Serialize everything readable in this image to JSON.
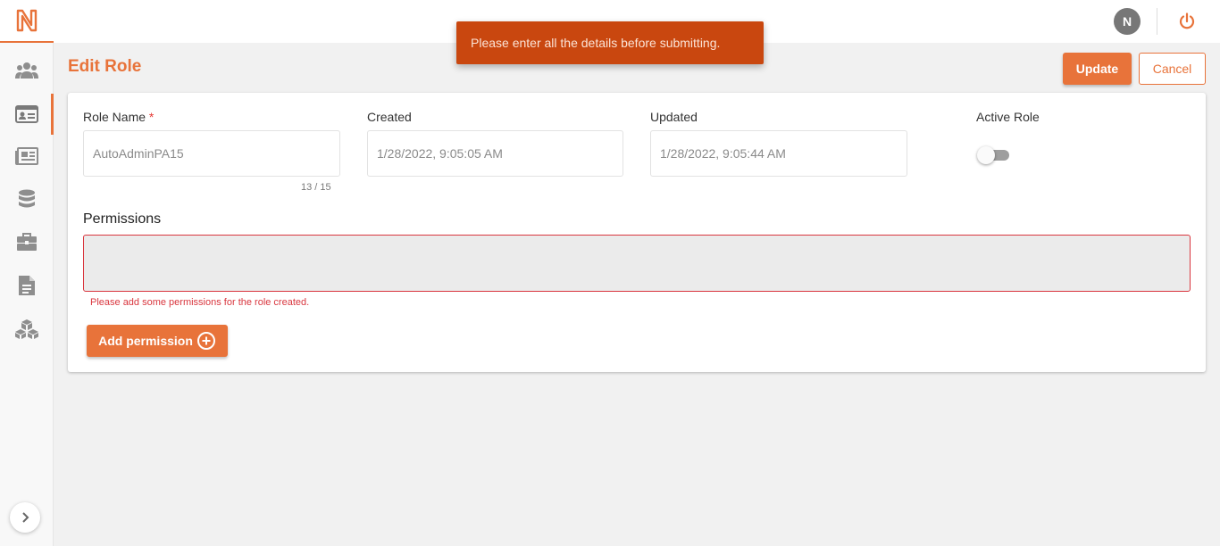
{
  "brand": {
    "accent": "#e8733a",
    "toast_bg": "#c9470f",
    "error": "#d9363e"
  },
  "sidebar": {
    "items": [
      {
        "icon": "users-icon"
      },
      {
        "icon": "id-card-icon",
        "active": true
      },
      {
        "icon": "newspaper-icon"
      },
      {
        "icon": "database-icon"
      },
      {
        "icon": "briefcase-icon"
      },
      {
        "icon": "document-icon"
      },
      {
        "icon": "cubes-icon"
      }
    ],
    "expand_icon": "chevron-right-icon"
  },
  "topbar": {
    "avatar_initial": "N",
    "power_icon": "power-icon"
  },
  "toast": {
    "message": "Please enter all the details before submitting."
  },
  "header": {
    "title": "Edit Role",
    "update_label": "Update",
    "cancel_label": "Cancel"
  },
  "form": {
    "role_name": {
      "label": "Role Name",
      "required_mark": "*",
      "value": "AutoAdminPA15",
      "counter": "13 / 15"
    },
    "created": {
      "label": "Created",
      "value": "1/28/2022, 9:05:05 AM"
    },
    "updated": {
      "label": "Updated",
      "value": "1/28/2022, 9:05:44 AM"
    },
    "active_role": {
      "label": "Active Role",
      "enabled": false
    }
  },
  "permissions": {
    "title": "Permissions",
    "error": "Please add some permissions for the role created.",
    "add_label": "Add permission"
  }
}
